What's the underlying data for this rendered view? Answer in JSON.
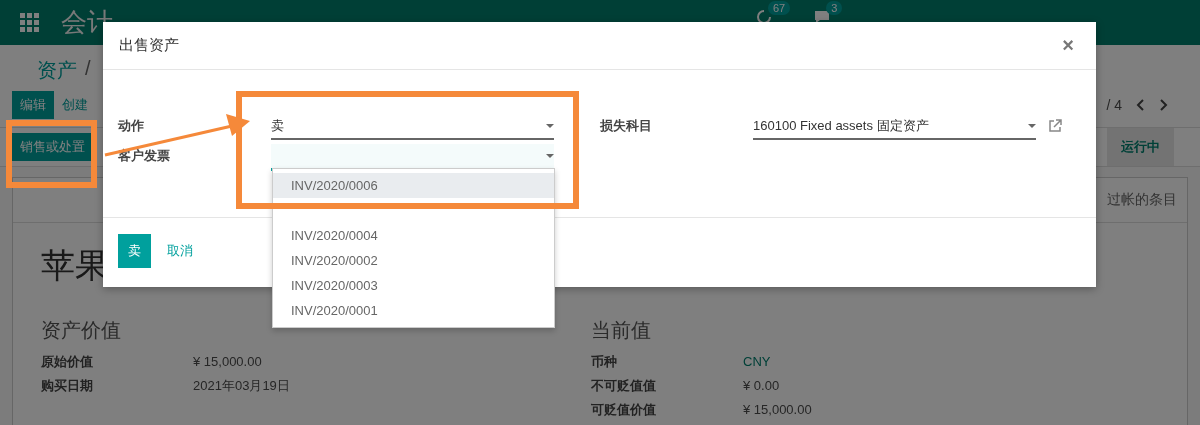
{
  "navbar": {
    "app_title": "会计",
    "activity_count": "67",
    "message_count": "3"
  },
  "breadcrumb": {
    "parent": "资产",
    "separator": "/"
  },
  "control_buttons": [
    {
      "label": "编辑",
      "primary": true
    },
    {
      "label": "创建",
      "primary": false
    }
  ],
  "pager": {
    "text": "/ 4"
  },
  "action_button": "销售或处置",
  "status_bar": [
    {
      "label": "运行中",
      "selected": true
    }
  ],
  "smart_button": "过帐的条目",
  "record_title": "苹果",
  "groups": [
    {
      "title": "资产价值",
      "fields": [
        {
          "label": "原始价值",
          "value": "¥ 15,000.00",
          "kind": "text"
        },
        {
          "label": "购买日期",
          "value": "2021年03月19日",
          "kind": "text"
        }
      ]
    },
    {
      "title": "当前值",
      "fields": [
        {
          "label": "币种",
          "value": "CNY",
          "kind": "link"
        },
        {
          "label": "不可贬值值",
          "value": "¥ 0.00",
          "kind": "text"
        },
        {
          "label": "可贬值价值",
          "value": "¥ 15,000.00",
          "kind": "text"
        }
      ]
    }
  ],
  "dialog": {
    "title": "出售资产",
    "close": "×",
    "left_fields": [
      {
        "label": "动作",
        "value": "卖",
        "focused": false
      },
      {
        "label": "客户发票",
        "focused": true
      }
    ],
    "right_fields": [
      {
        "label": "损失科目",
        "value": "160100 Fixed assets 固定资产",
        "focused": false,
        "external_link": true
      }
    ],
    "dropdown": [
      {
        "label": "INV/2020/0006",
        "selected": true
      },
      {
        "label": "INV/2020/0004",
        "selected": false
      },
      {
        "label": "INV/2020/0002",
        "selected": false
      },
      {
        "label": "INV/2020/0003",
        "selected": false
      },
      {
        "label": "INV/2020/0001",
        "selected": false
      }
    ],
    "buttons": [
      {
        "label": "卖",
        "kind": "primary"
      },
      {
        "label": "取消",
        "kind": "link"
      }
    ]
  }
}
